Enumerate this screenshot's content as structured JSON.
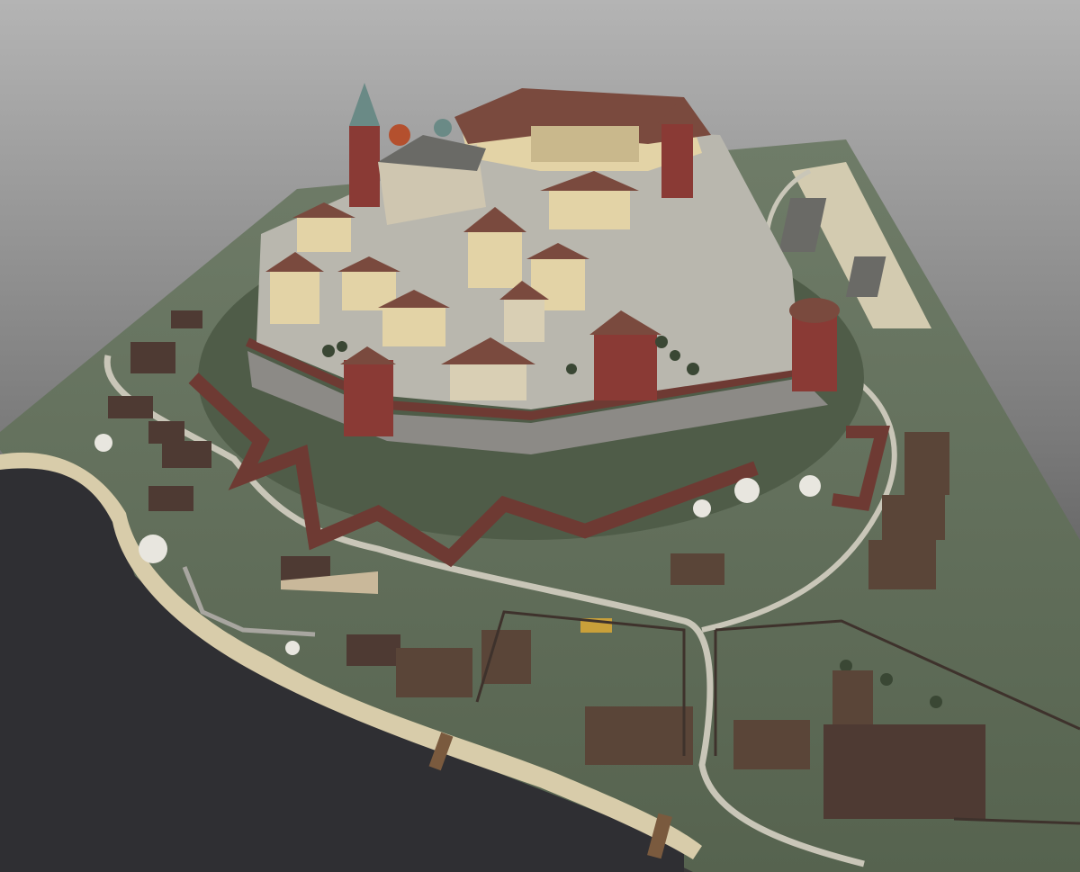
{
  "photo": {
    "subject": "architectural-model",
    "colors": {
      "backdrop_top": "#b4b4b4",
      "backdrop_bottom": "#383838",
      "water": "#2f2f33",
      "grass": "#5d6b56",
      "grass_light": "#7a8773",
      "path": "#c9c6b8",
      "sand": "#d8ccaa",
      "brick_wall": "#6e3a33",
      "stone_wall": "#8c8a86",
      "roof": "#7a4a3e",
      "roof_dark": "#4e3a33",
      "facade": "#e3d3a6",
      "tower": "#8a3a35",
      "spire": "#6a8a86"
    }
  }
}
